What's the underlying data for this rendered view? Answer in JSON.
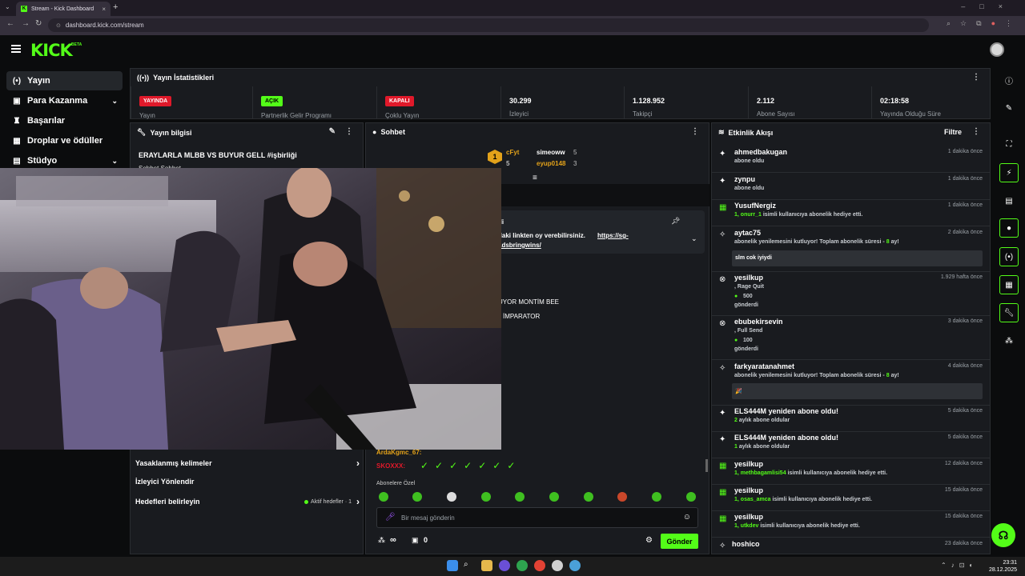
{
  "browser": {
    "tab_title": "Stream - Kick Dashboard",
    "url": "dashboard.kick.com/stream"
  },
  "header": {
    "logo": "KICK",
    "beta": "BETA"
  },
  "sidebar": {
    "items": [
      {
        "label": "Yayın",
        "icon": "broadcast-icon",
        "active": true
      },
      {
        "label": "Para Kazanma",
        "icon": "money-icon",
        "chevron": true
      },
      {
        "label": "Başarılar",
        "icon": "trophy-icon"
      },
      {
        "label": "Droplar ve ödüller",
        "icon": "gift-icon"
      },
      {
        "label": "Stüdyo",
        "icon": "studio-icon",
        "chevron": true
      }
    ]
  },
  "stats": {
    "title": "Yayın İstatistikleri",
    "items": [
      {
        "badge": "YAYINDA",
        "badge_color": "#e0192a",
        "label": "Yayın"
      },
      {
        "badge": "AÇIK",
        "badge_color": "#53fc18",
        "label": "Partnerlik Gelir Programı"
      },
      {
        "badge": "KAPALI",
        "badge_color": "#e0192a",
        "label": "Çoklu Yayın"
      },
      {
        "value": "30.299",
        "label": "İzleyici"
      },
      {
        "value": "1.128.952",
        "label": "Takipçi"
      },
      {
        "value": "2.112",
        "label": "Abone Sayısı"
      },
      {
        "value": "02:18:58",
        "label": "Yayında Olduğu Süre"
      }
    ]
  },
  "info": {
    "title": "Yayın bilgisi",
    "stream_title": "ERAYLARLA MLBB VS BUYUR GELL #işbirliği",
    "category": "Sohbet Sohbet",
    "links": [
      {
        "label": "Yasaklanmış kelimeler"
      },
      {
        "label": "İzleyici Yönlendir"
      },
      {
        "label": "Hedefleri belirleyin",
        "aktif": "Aktif hedefler · 1"
      }
    ]
  },
  "chat": {
    "title": "Sohbet",
    "top_gifters": [
      {
        "name": "cFyt",
        "count": "5"
      },
      {
        "name": "simeoww",
        "count": "5"
      },
      {
        "name": "eyup0148",
        "count": "3"
      }
    ],
    "pinned_label": "di",
    "pinned_text": "daki linkten oy verebilirsiniz.",
    "pinned_link": "https://sg-",
    "pinned_link2": "adsbringwins/",
    "line1": "UYOR MONTİM BEE",
    "line2": "İMPARATOR",
    "user1": "ArdaKgmc_67:",
    "user2": "SKOXXX:",
    "subscribers_only": "Abonelere Özel",
    "input_placeholder": "Bir mesaj gönderin",
    "points": "∞",
    "store_count": "0",
    "send_label": "Gönder"
  },
  "activity": {
    "title": "Etkinlik Akışı",
    "filter": "Filtre",
    "items": [
      {
        "name": "ahmedbakugan",
        "sub": "abone oldu",
        "time": "1 dakika önce",
        "icon": "sparkle-icon"
      },
      {
        "name": "zynpu",
        "sub": "abone oldu",
        "time": "1 dakika önce",
        "icon": "sparkle-icon"
      },
      {
        "name": "YusufNergiz",
        "sub_num": "1,",
        "sub_user": "onurr_1",
        "sub": "isimli kullanıcıya abonelik hediye etti.",
        "time": "1 dakika önce",
        "icon": "gift-icon"
      },
      {
        "name": "aytac75",
        "sub": "abonelik yenilemesini kutluyor! Toplam abonelik süresi -",
        "sub_num2": "8",
        "sub_tail": "ay!",
        "msg": "slm cok iyiydi",
        "time": "2 dakika önce",
        "icon": "party-icon"
      },
      {
        "name": "yesilkup",
        "sub_user": ", Rage Quit",
        "amount": "500",
        "sub": "gönderdi",
        "time": "1.929 hafta önce",
        "icon": "kicks-icon"
      },
      {
        "name": "ebubekirsevin",
        "sub_user": ", Full Send",
        "amount": "100",
        "sub": "gönderdi",
        "time": "3 dakika önce",
        "icon": "kicks-icon"
      },
      {
        "name": "farkyaratanahmet",
        "sub": "abonelik yenilemesini kutluyor! Toplam abonelik süresi -",
        "sub_num2": "8",
        "sub_tail": "ay!",
        "msg": "🎉",
        "time": "4 dakika önce",
        "icon": "party-icon"
      },
      {
        "name": "ELS444M yeniden abone oldu!",
        "sub_num": "2",
        "sub": "aylık abone oldular",
        "time": "5 dakika önce",
        "icon": "sparkle-icon"
      },
      {
        "name": "ELS444M yeniden abone oldu!",
        "sub_num": "1",
        "sub": "aylık abone oldular",
        "time": "5 dakika önce",
        "icon": "sparkle-icon"
      },
      {
        "name": "yesilkup",
        "sub_num": "1,",
        "sub_user": "methbagamlisi54",
        "sub": "isimli kullanıcıya abonelik hediye etti.",
        "time": "12 dakika önce",
        "icon": "gift-icon"
      },
      {
        "name": "yesilkup",
        "sub_num": "1,",
        "sub_user": "osas_amca",
        "sub": "isimli kullanıcıya abonelik hediye etti.",
        "time": "15 dakika önce",
        "icon": "gift-icon"
      },
      {
        "name": "yesilkup",
        "sub_num": "1,",
        "sub_user": "utkdev",
        "sub": "isimli kullanıcıya abonelik hediye etti.",
        "time": "15 dakika önce",
        "icon": "gift-icon"
      },
      {
        "name": "hoshico",
        "time": "23 dakika önce",
        "icon": "party-icon"
      }
    ]
  },
  "taskbar": {
    "time": "23:31",
    "date": "28.12.2025"
  },
  "colors": {
    "accent": "#53fc18",
    "live": "#e0192a"
  }
}
